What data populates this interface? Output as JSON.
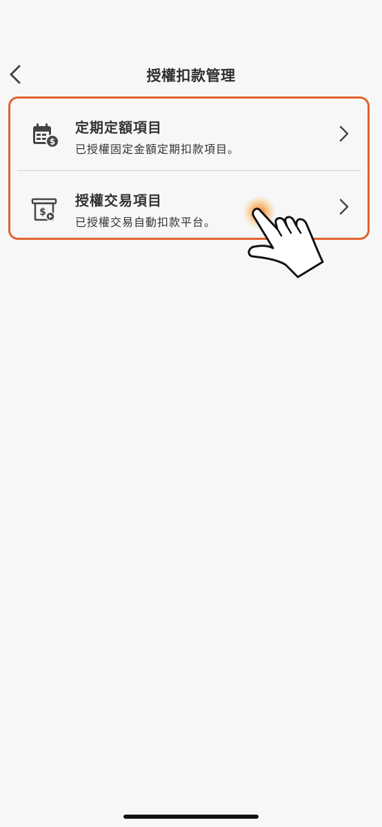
{
  "header": {
    "title": "授權扣款管理",
    "back_icon": "chevron-left-icon"
  },
  "items": [
    {
      "title": "定期定額項目",
      "subtitle": "已授權固定金額定期扣款項目。",
      "icon": "calendar-dollar-icon"
    },
    {
      "title": "授權交易項目",
      "subtitle": "已授權交易自動扣款平台。",
      "icon": "atm-dollar-icon"
    }
  ],
  "colors": {
    "accent": "#e2612b",
    "background": "#f6f7f6",
    "text": "#333333",
    "icon": "#444444"
  }
}
